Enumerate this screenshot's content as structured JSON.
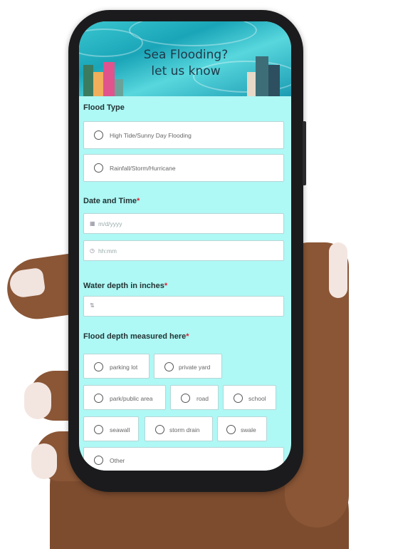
{
  "header": {
    "title_line1": "Sea Flooding?",
    "title_line2": "let us know"
  },
  "flood_type": {
    "label": "Flood Type",
    "options": [
      "High Tide/Sunny Day Flooding",
      "Rainfall/Storm/Hurricane"
    ]
  },
  "date_time": {
    "label": "Date and Time",
    "required_mark": "*",
    "date_placeholder": "m/d/yyyy",
    "time_placeholder": "hh:mm"
  },
  "water_depth": {
    "label": "Water depth in inches",
    "required_mark": "*",
    "value": ""
  },
  "measured_here": {
    "label": "Flood depth measured here",
    "required_mark": "*",
    "options": [
      "parking lot",
      "private yard",
      "park/public area",
      "road",
      "school",
      "seawall",
      "storm drain",
      "swale",
      "Other"
    ]
  },
  "colors": {
    "form_bg": "#aef8f5",
    "banner_water": "#1aa5b8",
    "required": "#d23",
    "phone_frame": "#1b1b1d",
    "skin": "#8a5636"
  },
  "icons": [
    "calendar-icon",
    "clock-icon",
    "number-icon",
    "radio-icon"
  ]
}
